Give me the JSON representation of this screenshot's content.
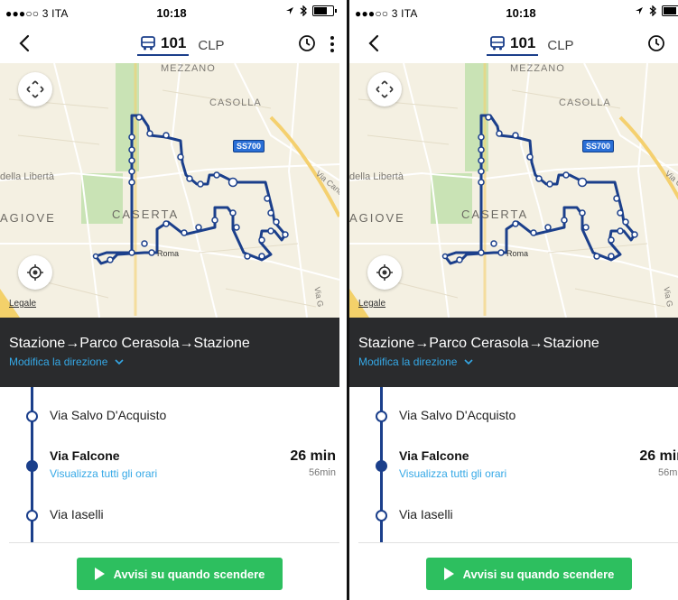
{
  "status": {
    "carrier": "●●●○○ 3 ITA",
    "time": "10:18"
  },
  "nav": {
    "route_number": "101",
    "operator": "CLP"
  },
  "map": {
    "labels": [
      "MEZZANO",
      "CASOLLA",
      "della Libertà",
      "AGIOVE",
      "CASERTA",
      "Roma",
      "Via Cancel",
      "Via G"
    ],
    "highway_badge": "SS700",
    "legal": "Legale",
    "route_color": "#1b3f8b"
  },
  "direction": {
    "title": "Stazione→Parco Cerasola→Stazione",
    "change_label": "Modifica la direzione"
  },
  "stops": [
    {
      "name": "Via Salvo D'Acquisto"
    },
    {
      "name": "Via Falcone",
      "link": "Visualizza tutti gli orari",
      "eta": "26 min",
      "eta_sub": "56min"
    },
    {
      "name": "Via Iaselli"
    }
  ],
  "cta": {
    "label": "Avvisi su quando scendere",
    "color": "#2dbf5f"
  }
}
